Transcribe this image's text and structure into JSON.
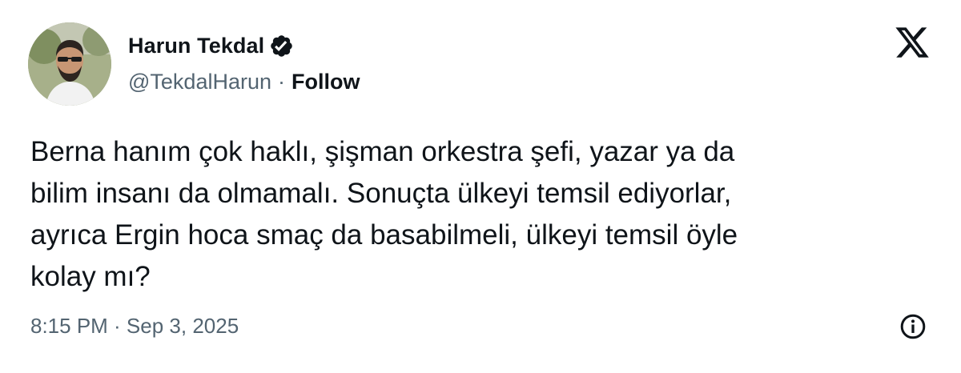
{
  "author": {
    "display_name": "Harun Tekdal",
    "handle": "@TekdalHarun",
    "separator": "·",
    "follow_label": "Follow",
    "verified_icon": "verified-badge-icon",
    "avatar_icon": "avatar-photo"
  },
  "tweet": {
    "text": "Berna hanım çok haklı, şişman orkestra şefi, yazar ya da\nbilim insanı da olmamalı. Sonuçta ülkeyi temsil ediyorlar,\nayrıca Ergin hoca smaç da basabilmeli, ülkeyi temsil öyle\nkolay mı?",
    "timestamp": "8:15 PM · Sep 3, 2025"
  },
  "icons": {
    "logo": "x-logo-icon",
    "info": "info-icon"
  },
  "colors": {
    "text_primary": "#0f1419",
    "text_secondary": "#536471",
    "background": "#ffffff"
  }
}
